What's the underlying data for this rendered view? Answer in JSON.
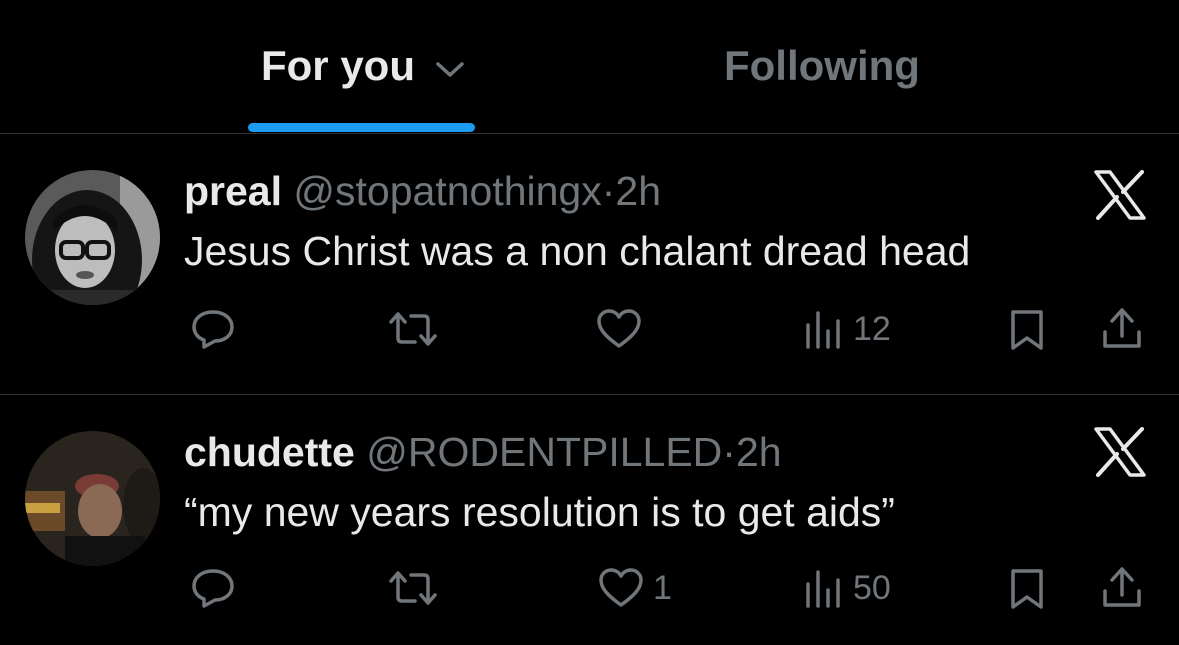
{
  "tabs": {
    "for_you": "For you",
    "following": "Following"
  },
  "posts": [
    {
      "name": "preal",
      "handle": "@stopatnothingx",
      "separator": "·",
      "time": "2h",
      "text": "Jesus Christ was a non chalant dread head",
      "likes": "",
      "views": "12"
    },
    {
      "name": "chudette",
      "handle": "@RODENTPILLED",
      "separator": "·",
      "time": "2h",
      "text": "“my new years resolution is to get aids”",
      "likes": "1",
      "views": "50"
    }
  ],
  "colors": {
    "accent": "#1d9bf0",
    "text": "#e7e9ea",
    "muted": "#71767b",
    "divider": "#2f3336"
  }
}
